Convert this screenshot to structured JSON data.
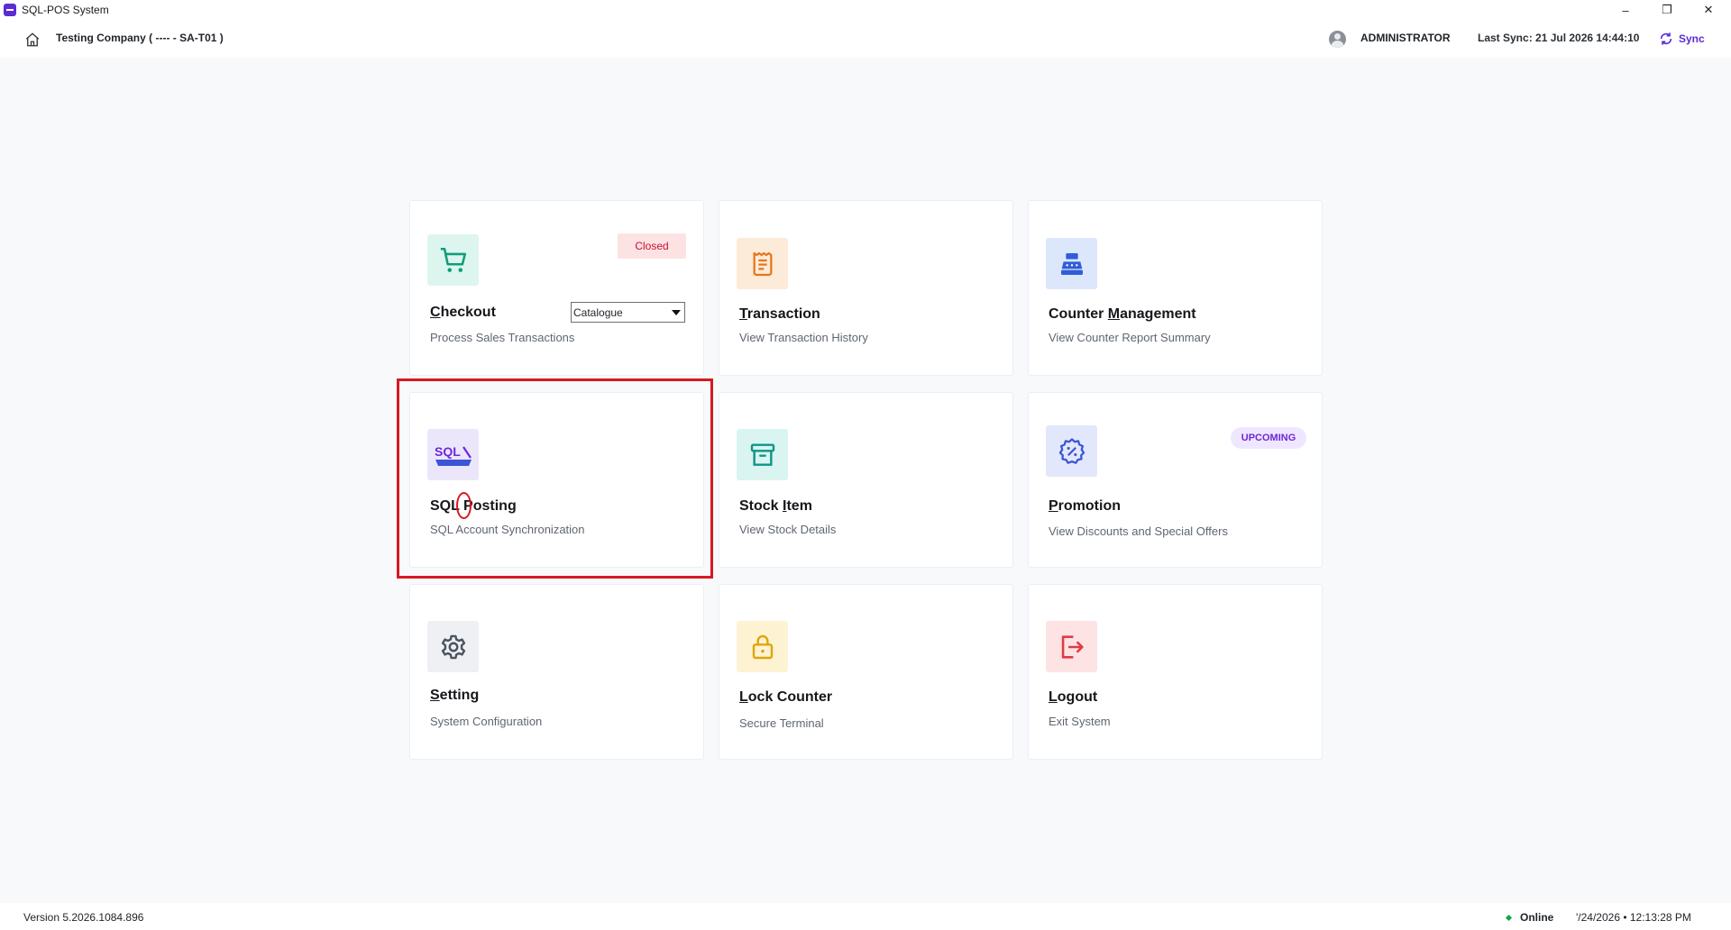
{
  "window": {
    "title": "SQL-POS System",
    "controls": {
      "minimize": "–",
      "restore": "❐",
      "close": "✕"
    },
    "brand_color": "#5b2bd6"
  },
  "header": {
    "company": "Testing Company ( ---- - SA-T01 )",
    "user": "ADMINISTRATOR",
    "last_sync": "Last Sync: 21 Jul 2026 14:44:10",
    "sync_label": "Sync"
  },
  "cards": {
    "checkout": {
      "title_first": "C",
      "title_rest": "heckout",
      "subtitle": "Process Sales Transactions",
      "badge": "Closed",
      "select_value": "Catalogue",
      "icon": "cart-icon",
      "icon_bg": "#ddf5ef",
      "icon_color": "#0f9d79"
    },
    "transaction": {
      "title_first": "T",
      "title_rest": "ransaction",
      "subtitle": "View Transaction History",
      "icon": "receipt-icon",
      "icon_bg": "#fdebd9",
      "icon_color": "#e8751a"
    },
    "counter": {
      "title_pre": "Counter ",
      "title_u": "M",
      "title_post": "anagement",
      "subtitle": "View Counter Report Summary",
      "icon": "cash-register-icon",
      "icon_bg": "#dde7fb",
      "icon_color": "#2f5fd6"
    },
    "sql_posting": {
      "title": "SQL Posting",
      "subtitle": "SQL Account Synchronization",
      "icon": "sql-account-logo",
      "logo_text": "SQL",
      "icon_bg": "#ece6fb"
    },
    "stock": {
      "title_pre": "Stock ",
      "title_u": "I",
      "title_post": "tem",
      "subtitle": "View Stock Details",
      "icon": "archive-box-icon",
      "icon_bg": "#d9f4f1",
      "icon_color": "#0f9488"
    },
    "promotion": {
      "title_first": "P",
      "title_rest": "romotion",
      "subtitle": "View Discounts and Special Offers",
      "badge": "UPCOMING",
      "icon": "discount-badge-icon",
      "icon_bg": "#e3e7fb",
      "icon_color": "#3b55d6"
    },
    "setting": {
      "title_first": "S",
      "title_rest": "etting",
      "subtitle": "System Configuration",
      "icon": "gear-icon",
      "icon_bg": "#eef0f3",
      "icon_color": "#4b5260"
    },
    "lock": {
      "title_first": "L",
      "title_rest": "ock Counter",
      "subtitle": "Secure Terminal",
      "icon": "lock-icon",
      "icon_bg": "#fdf3d3",
      "icon_color": "#e0a40b"
    },
    "logout": {
      "title_first": "L",
      "title_rest": "ogout",
      "subtitle": "Exit System",
      "icon": "logout-icon",
      "icon_bg": "#fde3e4",
      "icon_color": "#e03b43"
    }
  },
  "footer": {
    "version": "Version 5.2026.1084.896",
    "status": "Online",
    "status_color": "#16a34a",
    "datetime": "'/24/2026  •  12:13:28 PM"
  }
}
